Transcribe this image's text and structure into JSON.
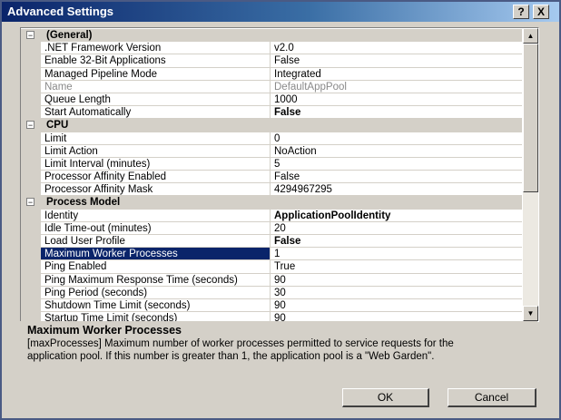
{
  "window": {
    "title": "Advanced Settings",
    "help_label": "?",
    "close_label": "X"
  },
  "categories": [
    {
      "name": "(General)",
      "toggle": "−",
      "properties": [
        {
          "name": ".NET Framework Version",
          "value": "v2.0"
        },
        {
          "name": "Enable 32-Bit Applications",
          "value": "False"
        },
        {
          "name": "Managed Pipeline Mode",
          "value": "Integrated"
        },
        {
          "name": "Name",
          "value": "DefaultAppPool",
          "disabled": true
        },
        {
          "name": "Queue Length",
          "value": "1000"
        },
        {
          "name": "Start Automatically",
          "value": "False",
          "bold": true
        }
      ]
    },
    {
      "name": "CPU",
      "toggle": "−",
      "properties": [
        {
          "name": "Limit",
          "value": "0"
        },
        {
          "name": "Limit Action",
          "value": "NoAction"
        },
        {
          "name": "Limit Interval (minutes)",
          "value": "5"
        },
        {
          "name": "Processor Affinity Enabled",
          "value": "False"
        },
        {
          "name": "Processor Affinity Mask",
          "value": "4294967295"
        }
      ]
    },
    {
      "name": "Process Model",
      "toggle": "−",
      "properties": [
        {
          "name": "Identity",
          "value": "ApplicationPoolIdentity",
          "bold": true
        },
        {
          "name": "Idle Time-out (minutes)",
          "value": "20"
        },
        {
          "name": "Load User Profile",
          "value": "False",
          "bold": true
        },
        {
          "name": "Maximum Worker Processes",
          "value": "1",
          "selected": true
        },
        {
          "name": "Ping Enabled",
          "value": "True"
        },
        {
          "name": "Ping Maximum Response Time (seconds)",
          "value": "90"
        },
        {
          "name": "Ping Period (seconds)",
          "value": "30"
        },
        {
          "name": "Shutdown Time Limit (seconds)",
          "value": "90"
        },
        {
          "name": "Startup Time Limit (seconds)",
          "value": "90"
        }
      ]
    }
  ],
  "scrollbar": {
    "up_icon": "▲",
    "down_icon": "▼"
  },
  "description": {
    "title": "Maximum Worker Processes",
    "text": "[maxProcesses] Maximum number of worker processes permitted to service requests for the application pool. If this number is greater than 1, the application pool is a \"Web Garden\"."
  },
  "buttons": {
    "ok": "OK",
    "cancel": "Cancel"
  }
}
